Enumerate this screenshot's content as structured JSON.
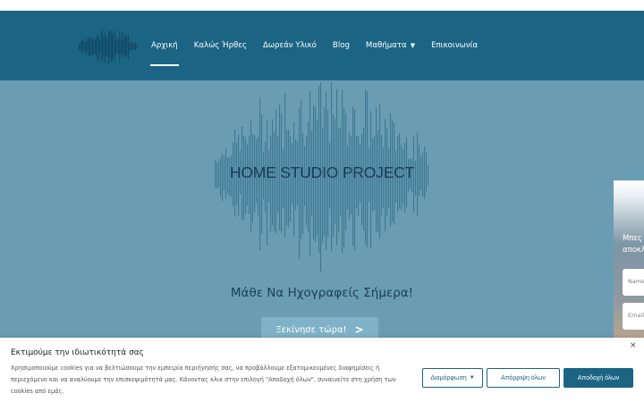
{
  "header": {
    "logo_text": "HOME STUDIO PROJECT",
    "nav": [
      {
        "label": "Αρχική",
        "active": true
      },
      {
        "label": "Καλώς Ήρθες"
      },
      {
        "label": "Δωρεάν Υλικό"
      },
      {
        "label": "Blog"
      },
      {
        "label": "Μαθήματα",
        "dropdown": true
      },
      {
        "label": "Επικοινωνία"
      }
    ],
    "dropdown_icon": "chevron-down-icon"
  },
  "hero": {
    "title": "HOME STUDIO PROJECT",
    "tagline": "Μάθε Να Ηχογραφείς Σήμερα!",
    "cta_label": "Ξεκίνησε τώρα!",
    "cta_arrow": ">"
  },
  "side_widget": {
    "line1": "Μπες",
    "line2": "αποκλ",
    "name_placeholder": "Name",
    "email_placeholder": "Email"
  },
  "cookie_banner": {
    "title": "Εκτιμούμε την ιδιωτικότητά σας",
    "text": "Χρησιμοποιούμε cookies για να βελτιώσουμε την εμπειρία περιήγησής σας, να προβάλλουμε εξατομικευμένες διαφημίσεις ή περιεχόμενο και να αναλύουμε την επισκεψιμότητά μας. Κάνοντας κλικ στην επιλογή \"Αποδοχή όλων\", συναινείτε στη χρήση των cookies από εμάς.",
    "close": "×",
    "customize_label": "Διαμόρφωση",
    "reject_label": "Απόρριψη όλων",
    "accept_label": "Αποδοχή όλων"
  },
  "colors": {
    "header_bg": "#1b6483",
    "hero_bg": "#6a9db4",
    "cta_bg": "#7fb2c8",
    "accent": "#1b6483"
  }
}
